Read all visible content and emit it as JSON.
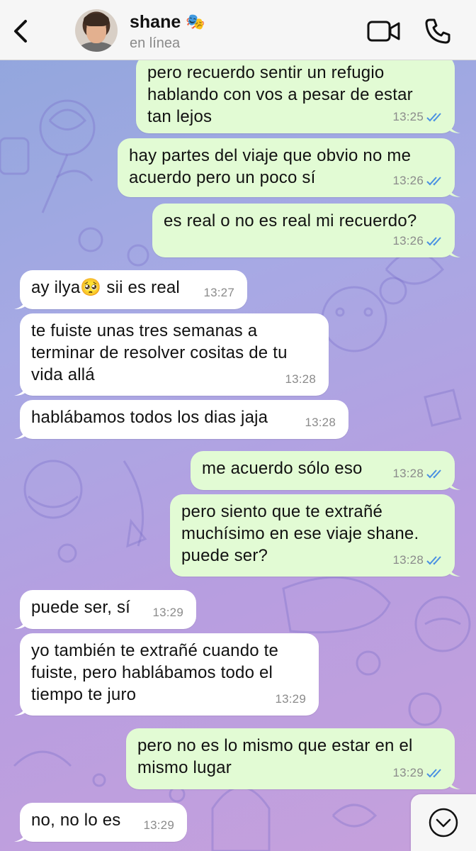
{
  "header": {
    "contact_name": "shane",
    "name_emoji": "🎭",
    "status": "en línea",
    "icons": {
      "back": "chevron-left-icon",
      "video": "video-camera-icon",
      "call": "phone-icon"
    }
  },
  "colors": {
    "outgoing_bubble": "#e2fbd4",
    "incoming_bubble": "#ffffff",
    "read_ticks": "#4a90e2",
    "header_bg": "#f6f6f6"
  },
  "messages": [
    {
      "direction": "out",
      "text": "pero recuerdo sentir un refugio\nhablando con vos a pesar de estar\ntan lejos",
      "time": "13:25",
      "read": true
    },
    {
      "direction": "out",
      "text": "hay partes del viaje que obvio no me\nacuerdo pero un poco sí",
      "time": "13:26",
      "read": true
    },
    {
      "direction": "out",
      "text": "es real o no es real mi recuerdo?",
      "time": "13:26",
      "read": true
    },
    {
      "direction": "in",
      "text": "ay ilya🥺 sii es real",
      "time": "13:27"
    },
    {
      "direction": "in",
      "text": "te fuiste unas tres semanas a\nterminar de resolver cositas de tu\nvida allá",
      "time": "13:28"
    },
    {
      "direction": "in",
      "text": "hablábamos todos los dias jaja",
      "time": "13:28"
    },
    {
      "direction": "out",
      "text": "me acuerdo sólo eso",
      "time": "13:28",
      "read": true
    },
    {
      "direction": "out",
      "text": "pero siento que te extrañé\nmuchísimo en ese viaje shane.\npuede ser?",
      "time": "13:28",
      "read": true
    },
    {
      "direction": "in",
      "text": "puede ser, sí",
      "time": "13:29"
    },
    {
      "direction": "in",
      "text": "yo también te extrañé cuando te\nfuiste, pero hablábamos todo el\ntiempo te juro",
      "time": "13:29"
    },
    {
      "direction": "out",
      "text": "pero no es lo mismo que estar en el\nmismo lugar",
      "time": "13:29",
      "read": true
    },
    {
      "direction": "in",
      "text": "no, no lo es",
      "time": "13:29"
    }
  ],
  "scroll_down_icon": "chevron-down-circle-icon"
}
